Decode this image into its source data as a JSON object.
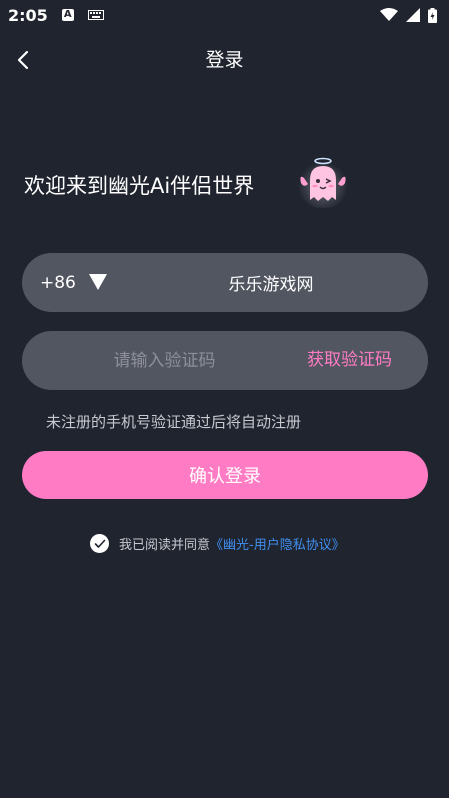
{
  "status_bar": {
    "time": "2:05",
    "a_badge": "A"
  },
  "nav": {
    "title": "登录"
  },
  "welcome_text": "欢迎来到幽光Ai伴侣世界",
  "phone": {
    "country_code": "+86",
    "value": "乐乐游戏网"
  },
  "verify": {
    "placeholder": "请输入验证码",
    "get_code_label": "获取验证码"
  },
  "hint": "未注册的手机号验证通过后将自动注册",
  "confirm_label": "确认登录",
  "agreement": {
    "text": "我已阅读并同意",
    "link": "《幽光-用户隐私协议》"
  },
  "colors": {
    "background": "#20242f",
    "field": "#525661",
    "accent": "#ff7cc4",
    "link": "#3f8ff0"
  },
  "icons": [
    "back-icon",
    "wifi-icon",
    "signal-icon",
    "battery-icon",
    "keyboard-icon",
    "dropdown-arrow-icon",
    "check-icon",
    "ghost-mascot-icon"
  ]
}
